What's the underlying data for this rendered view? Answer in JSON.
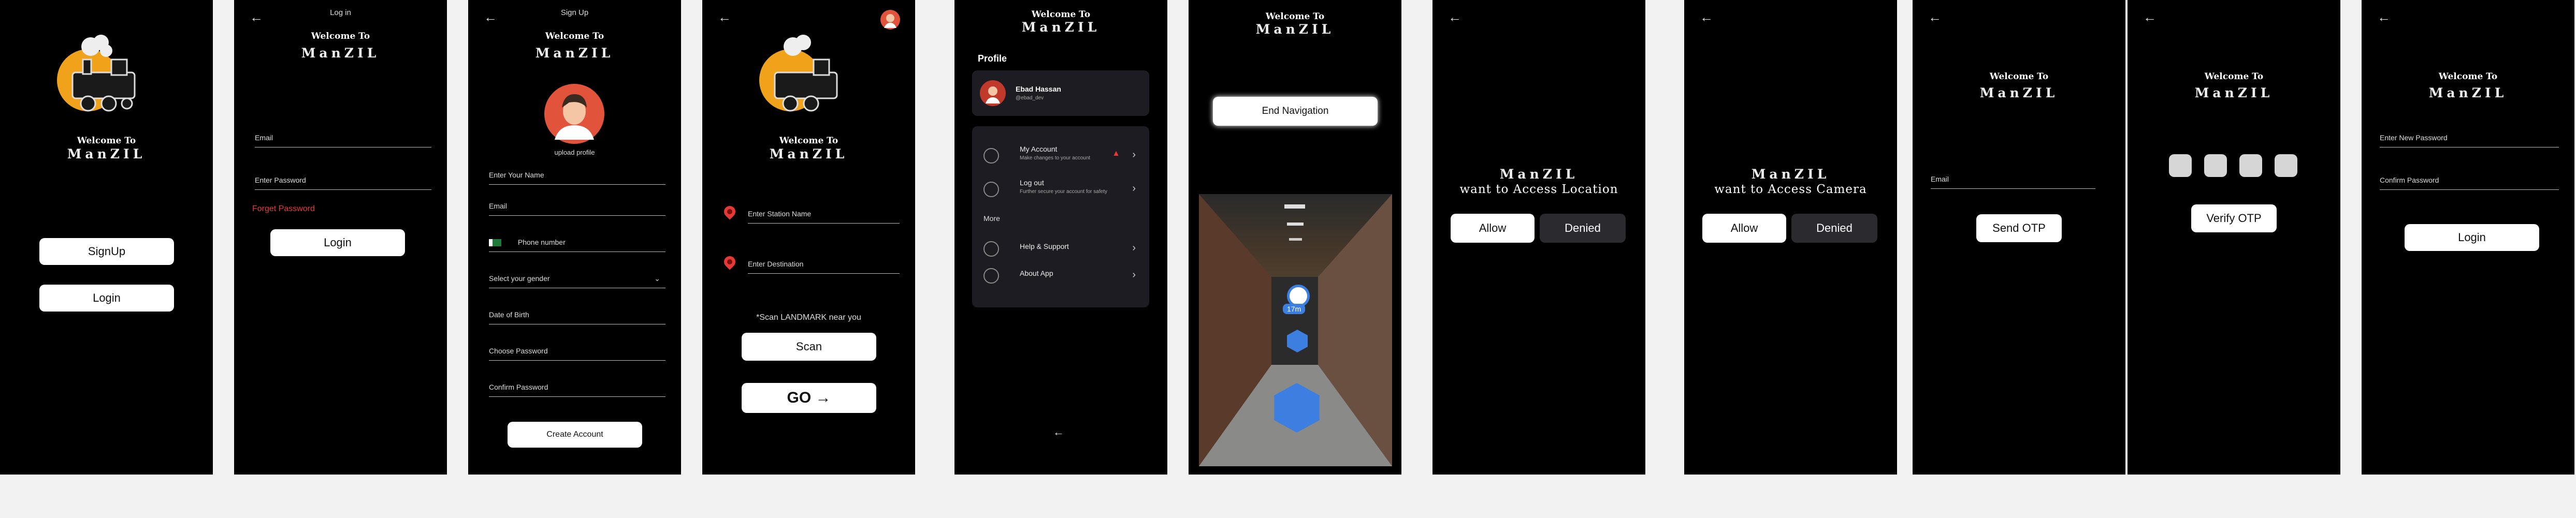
{
  "screen1": {
    "welcome": "Welcome To",
    "brand": "ManZIL",
    "signup": "SignUp",
    "login": "Login"
  },
  "screen2": {
    "header": "Log in",
    "welcome": "Welcome To",
    "brand": "ManZIL",
    "email_placeholder": "Email",
    "password_placeholder": "Enter Password",
    "forgot": "Forget Password",
    "login": "Login"
  },
  "screen3": {
    "header": "Sign Up",
    "welcome": "Welcome To",
    "brand": "ManZIL",
    "upload_profile": "upload profile",
    "name_label": "Enter Your Name",
    "email": "Email",
    "phone": "Phone number",
    "gender": "Select your gender",
    "dob": "Date of Birth",
    "password": "Choose Password",
    "confirm": "Confirm Password",
    "create": "Create Account"
  },
  "screen4": {
    "welcome": "Welcome To",
    "brand": "ManZIL",
    "station": "Enter Station Name",
    "destination": "Enter Destination",
    "scan_hint": "*Scan LANDMARK  near you",
    "scan": "Scan",
    "go": "GO"
  },
  "screen5": {
    "welcome": "Welcome To",
    "brand": "ManZIL",
    "profile": "Profile",
    "user_name": "Ebad Hassan",
    "user_handle": "@ebad_dev",
    "my_account": "My Account",
    "my_account_sub": "Make changes to your account",
    "logout": "Log out",
    "logout_sub": "Further secure your account for safety",
    "more": "More",
    "help": "Help & Support",
    "about": "About App"
  },
  "screen6": {
    "welcome": "Welcome To",
    "brand": "ManZIL",
    "end_nav": "End Navigation",
    "distance": "17m"
  },
  "screen7": {
    "brand": "ManZIL",
    "request": "want to Access Location",
    "allow": "Allow",
    "deny": "Denied"
  },
  "screen8": {
    "brand": "ManZIL",
    "request": "want to Access Camera",
    "allow": "Allow",
    "deny": "Denied"
  },
  "screen9": {
    "welcome": "Welcome To",
    "brand": "ManZIL",
    "email": "Email",
    "send_otp": "Send OTP"
  },
  "screen10": {
    "welcome": "Welcome To",
    "brand": "ManZIL",
    "verify_otp": "Verify OTP"
  },
  "screen11": {
    "welcome": "Welcome To",
    "brand": "ManZIL",
    "new_password": "Enter New Password",
    "confirm_password": "Confirm  Password",
    "login": "Login"
  },
  "colors": {
    "background": "#000000",
    "page": "#f2f2f2",
    "accent_red": "#e53935",
    "accent_blue": "#3d7fe0"
  }
}
